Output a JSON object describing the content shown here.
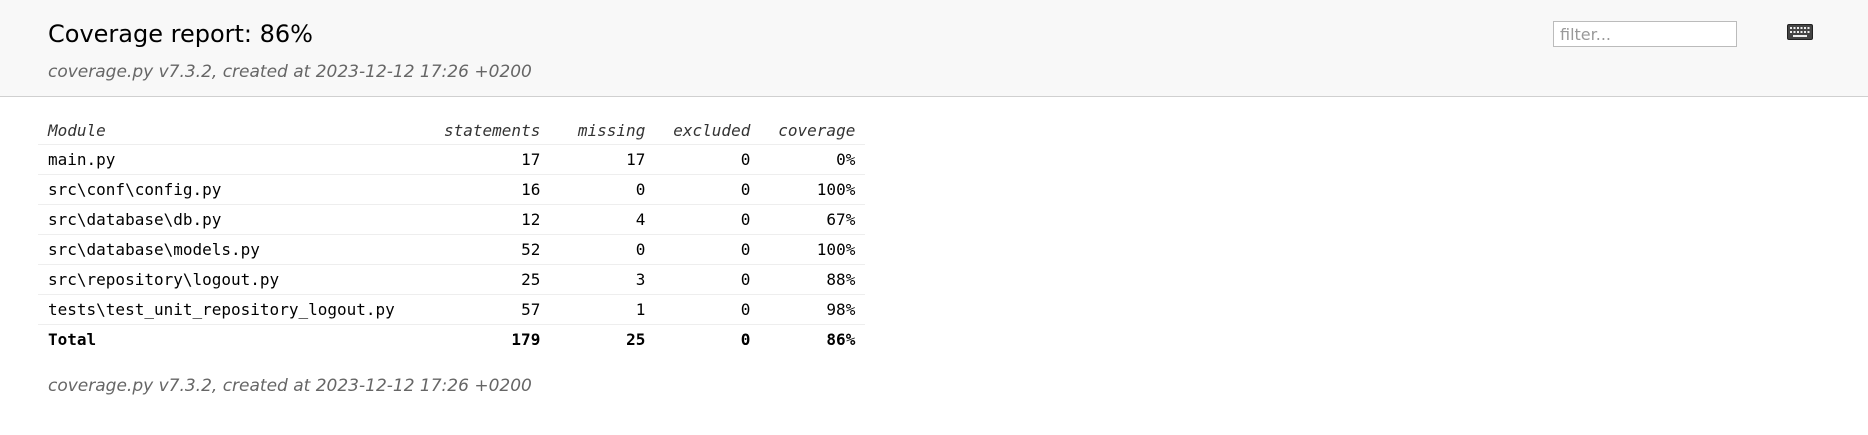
{
  "header": {
    "title": "Coverage report: 86%",
    "created": "coverage.py v7.3.2, created at 2023-12-12 17:26 +0200",
    "filter_placeholder": "filter..."
  },
  "icons": {
    "keyboard": "keyboard-icon"
  },
  "table": {
    "columns": [
      "Module",
      "statements",
      "missing",
      "excluded",
      "coverage"
    ],
    "rows": [
      {
        "module": "main.py",
        "statements": "17",
        "missing": "17",
        "excluded": "0",
        "coverage": "0%"
      },
      {
        "module": "src\\conf\\config.py",
        "statements": "16",
        "missing": "0",
        "excluded": "0",
        "coverage": "100%"
      },
      {
        "module": "src\\database\\db.py",
        "statements": "12",
        "missing": "4",
        "excluded": "0",
        "coverage": "67%"
      },
      {
        "module": "src\\database\\models.py",
        "statements": "52",
        "missing": "0",
        "excluded": "0",
        "coverage": "100%"
      },
      {
        "module": "src\\repository\\logout.py",
        "statements": "25",
        "missing": "3",
        "excluded": "0",
        "coverage": "88%"
      },
      {
        "module": "tests\\test_unit_repository_logout.py",
        "statements": "57",
        "missing": "1",
        "excluded": "0",
        "coverage": "98%"
      }
    ],
    "total": {
      "module": "Total",
      "statements": "179",
      "missing": "25",
      "excluded": "0",
      "coverage": "86%"
    }
  },
  "footer": {
    "created": "coverage.py v7.3.2, created at 2023-12-12 17:26 +0200"
  }
}
